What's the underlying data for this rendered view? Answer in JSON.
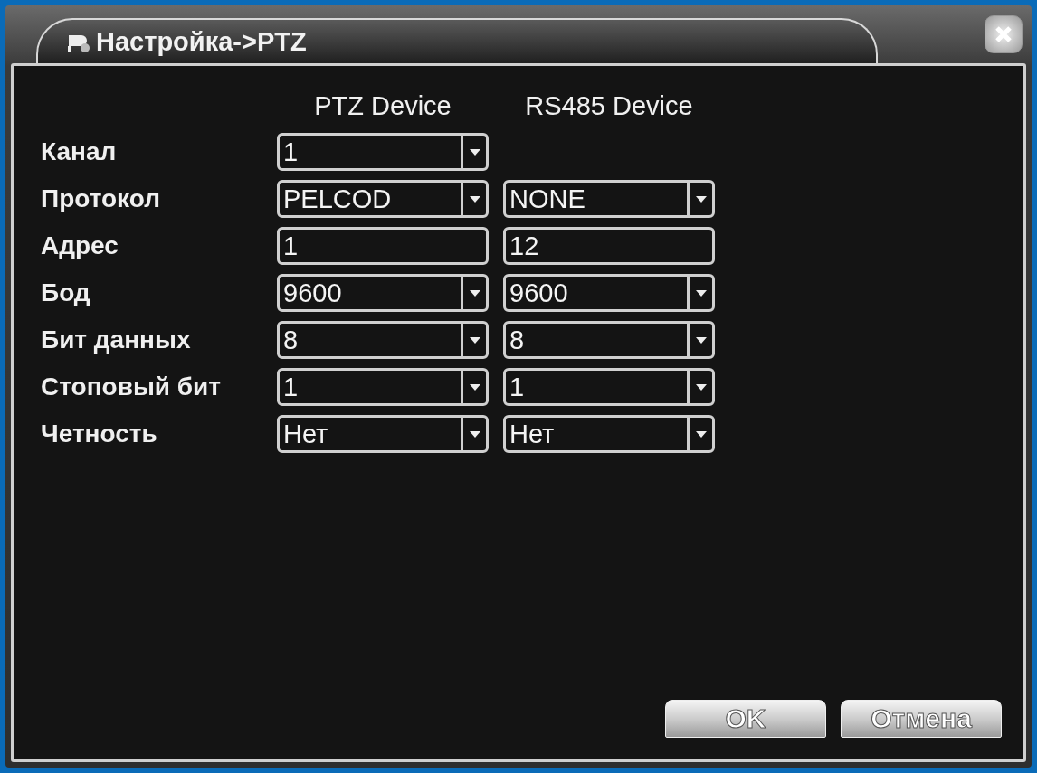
{
  "window": {
    "title": "Настройка->PTZ"
  },
  "columns": [
    "PTZ Device",
    "RS485 Device"
  ],
  "rows": [
    {
      "label": "Канал",
      "fields": [
        {
          "kind": "select",
          "value": "1"
        }
      ]
    },
    {
      "label": "Протокол",
      "fields": [
        {
          "kind": "select",
          "value": "PELCOD"
        },
        {
          "kind": "select",
          "value": "NONE"
        }
      ]
    },
    {
      "label": "Адрес",
      "fields": [
        {
          "kind": "text",
          "value": "1"
        },
        {
          "kind": "text",
          "value": "12"
        }
      ]
    },
    {
      "label": "Бод",
      "fields": [
        {
          "kind": "select",
          "value": "9600"
        },
        {
          "kind": "select",
          "value": "9600"
        }
      ]
    },
    {
      "label": "Бит данных",
      "fields": [
        {
          "kind": "select",
          "value": "8"
        },
        {
          "kind": "select",
          "value": "8"
        }
      ]
    },
    {
      "label": "Стоповый бит",
      "fields": [
        {
          "kind": "select",
          "value": "1"
        },
        {
          "kind": "select",
          "value": "1"
        }
      ]
    },
    {
      "label": "Четность",
      "fields": [
        {
          "kind": "select",
          "value": "Нет"
        },
        {
          "kind": "select",
          "value": "Нет"
        }
      ]
    }
  ],
  "buttons": [
    "OK",
    "Отмена"
  ]
}
